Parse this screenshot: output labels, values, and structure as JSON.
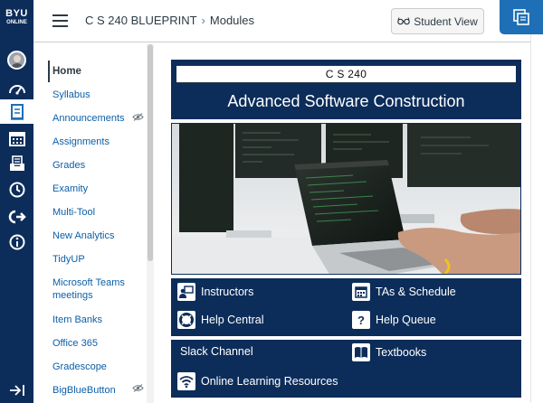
{
  "global_nav": {
    "logo_top": "BYU",
    "logo_bottom": "ONLINE",
    "items": [
      "account",
      "dashboard",
      "courses",
      "calendar",
      "inbox",
      "history",
      "commons",
      "help"
    ]
  },
  "header": {
    "course": "C S 240 BLUEPRINT",
    "separator": "›",
    "page": "Modules",
    "student_view": "Student View"
  },
  "course_nav": {
    "items": [
      {
        "label": "Home"
      },
      {
        "label": "Syllabus"
      },
      {
        "label": "Announcements"
      },
      {
        "label": "Assignments"
      },
      {
        "label": "Grades"
      },
      {
        "label": "Examity"
      },
      {
        "label": "Multi-Tool"
      },
      {
        "label": "New Analytics"
      },
      {
        "label": "TidyUP"
      },
      {
        "label": "Microsoft Teams meetings",
        "line1": "Microsoft Teams",
        "line2": "meetings"
      },
      {
        "label": "Item Banks"
      },
      {
        "label": "Office 365"
      },
      {
        "label": "Gradescope"
      },
      {
        "label": "BigBlueButton"
      }
    ]
  },
  "banner": {
    "code": "C S 240",
    "title": "Advanced Software Construction"
  },
  "links": {
    "instructors": "Instructors",
    "tas": "TAs & Schedule",
    "help_central": "Help Central",
    "help_queue": "Help Queue",
    "slack": "Slack Channel",
    "textbooks": "Textbooks",
    "online": "Online Learning Resources"
  },
  "colors": {
    "navy": "#0c2d5a",
    "link_blue": "#0b5fa8",
    "accent_blue": "#1e6fb5"
  }
}
